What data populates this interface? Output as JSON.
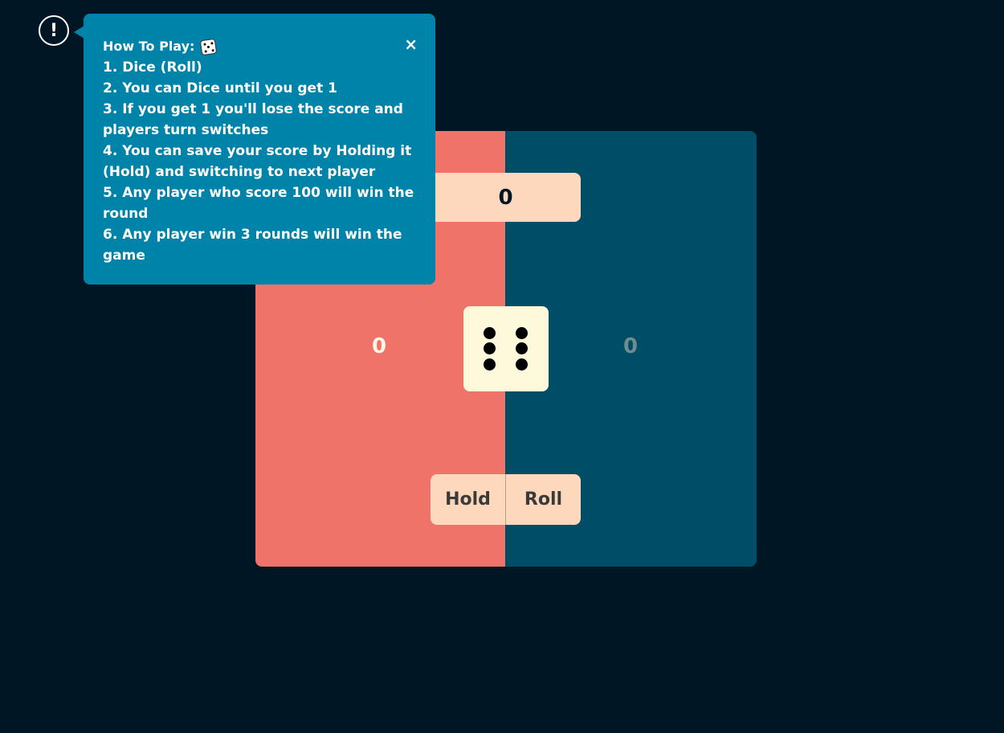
{
  "game": {
    "current_score": "0",
    "player1_score": "0",
    "player2_score": "0",
    "dice_value": 6,
    "hold_label": "Hold",
    "roll_label": "Roll"
  },
  "info": {
    "icon_glyph": "!"
  },
  "tooltip": {
    "title": "How To Play:",
    "title_icon": "dice-icon",
    "close_glyph": "×",
    "rules": [
      "1. Dice (Roll)",
      "2. You can Dice until you get 1",
      "3. If you get 1 you'll lose the score and players turn switches",
      "4. You can save your score by Holding it (Hold) and switching to next player",
      "5. Any player who score 100 will win the round",
      "6. Any player win 3 rounds will win the game"
    ]
  },
  "colors": {
    "background": "#001624",
    "player1_active": "#f0736a",
    "player2_inactive": "#004d67",
    "score_box": "#fdd8bc",
    "dice_face": "#fff9dc",
    "tooltip": "#0083a8"
  }
}
